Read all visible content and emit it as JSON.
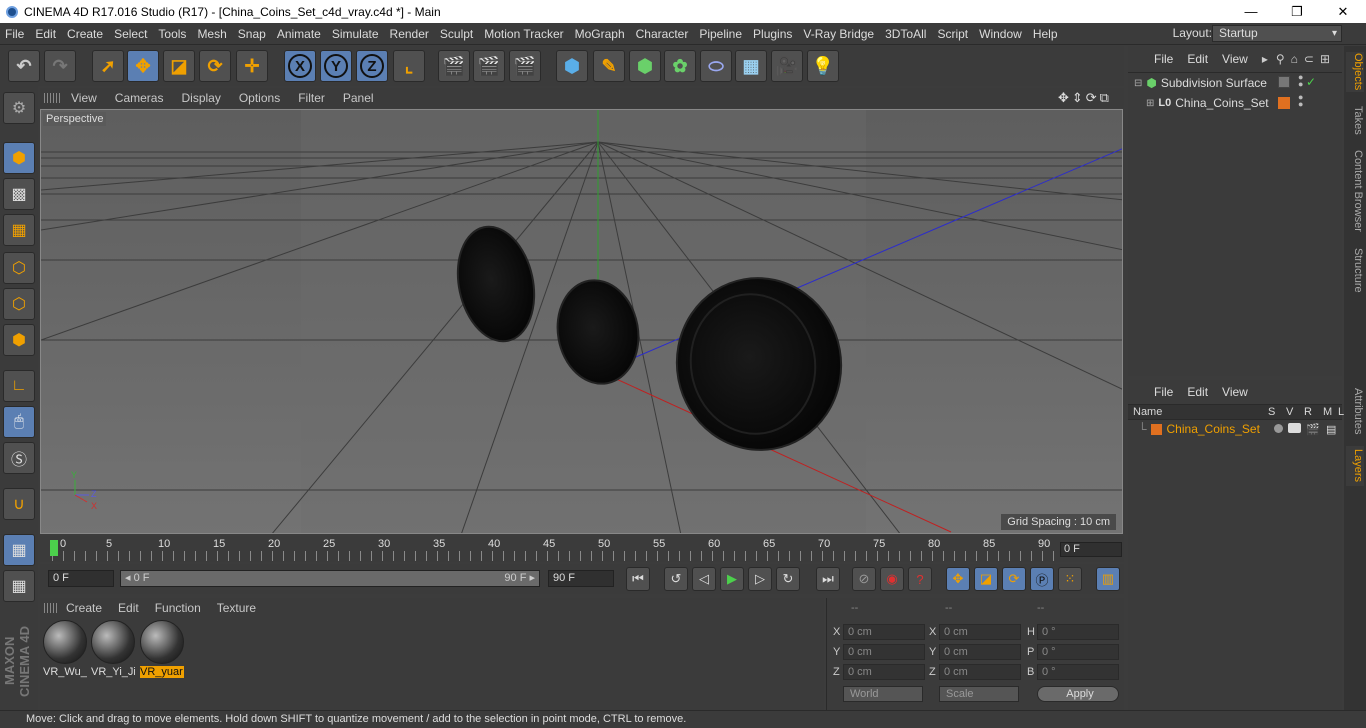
{
  "window": {
    "title": "CINEMA 4D R17.016 Studio (R17) - [China_Coins_Set_c4d_vray.c4d *] - Main",
    "controls": [
      "—",
      "❐",
      "✕"
    ]
  },
  "menu": [
    "File",
    "Edit",
    "Create",
    "Select",
    "Tools",
    "Mesh",
    "Snap",
    "Animate",
    "Simulate",
    "Render",
    "Sculpt",
    "Motion Tracker",
    "MoGraph",
    "Character",
    "Pipeline",
    "Plugins",
    "V-Ray Bridge",
    "3DToAll",
    "Script",
    "Window",
    "Help"
  ],
  "layout": {
    "label": "Layout:",
    "value": "Startup"
  },
  "viewport": {
    "menu": [
      "View",
      "Cameras",
      "Display",
      "Options",
      "Filter",
      "Panel"
    ],
    "label": "Perspective",
    "grid_spacing": "Grid Spacing : 10 cm",
    "axis": {
      "y": "Y",
      "z": "Z",
      "x": "X"
    }
  },
  "timeline": {
    "ticks": [
      "0",
      "5",
      "10",
      "15",
      "20",
      "25",
      "30",
      "35",
      "40",
      "45",
      "50",
      "55",
      "60",
      "65",
      "70",
      "75",
      "80",
      "85",
      "90"
    ],
    "current": "0 F"
  },
  "transport": {
    "start": "0 F",
    "range_start": "◂ 0 F",
    "range_end": "90 F ▸",
    "end": "90 F"
  },
  "materials": {
    "menu": [
      "Create",
      "Edit",
      "Function",
      "Texture"
    ],
    "items": [
      {
        "label": "VR_Wu_"
      },
      {
        "label": "VR_Yi_Ji"
      },
      {
        "label": "VR_yuar"
      }
    ]
  },
  "coords": {
    "headers": [
      "--",
      "--",
      "--"
    ],
    "rows": [
      {
        "a": "X",
        "av": "0 cm",
        "b": "X",
        "bv": "0 cm",
        "c": "H",
        "cv": "0 °"
      },
      {
        "a": "Y",
        "av": "0 cm",
        "b": "Y",
        "bv": "0 cm",
        "c": "P",
        "cv": "0 °"
      },
      {
        "a": "Z",
        "av": "0 cm",
        "b": "Z",
        "bv": "0 cm",
        "c": "B",
        "cv": "0 °"
      }
    ],
    "mode1": "World",
    "mode2": "Scale",
    "apply": "Apply"
  },
  "object_manager": {
    "menu": [
      "File",
      "Edit",
      "View"
    ],
    "objects": [
      {
        "name": "Subdivision Surface"
      },
      {
        "name": "China_Coins_Set"
      }
    ]
  },
  "layer_manager": {
    "menu": [
      "File",
      "Edit",
      "View"
    ],
    "columns": [
      "Name",
      "S",
      "V",
      "R",
      "M",
      "L"
    ],
    "layers": [
      {
        "name": "China_Coins_Set",
        "color": "#e07020"
      }
    ]
  },
  "side_tabs": [
    "Objects",
    "Takes",
    "Content Browser",
    "Structure",
    "Attributes",
    "Layers"
  ],
  "status": "Move: Click and drag to move elements. Hold down SHIFT to quantize movement / add to the selection in point mode, CTRL to remove."
}
